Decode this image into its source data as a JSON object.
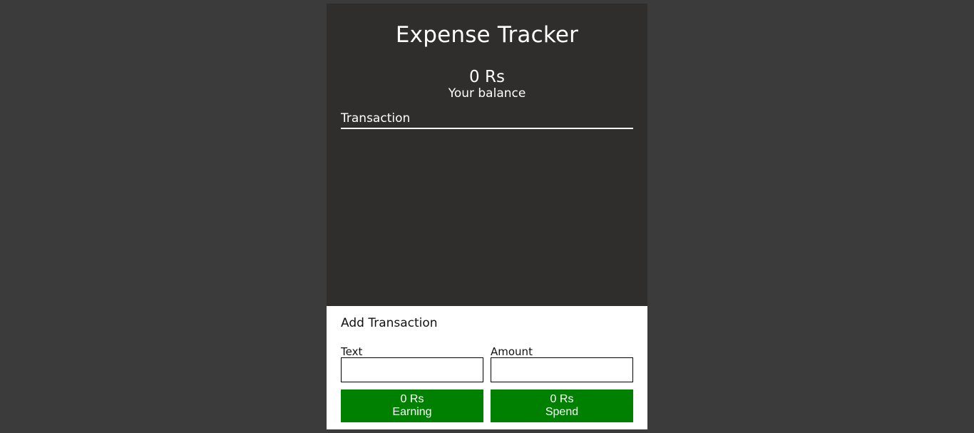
{
  "app": {
    "title": "Expense Tracker"
  },
  "balance": {
    "amount": "0 Rs",
    "label": "Your balance"
  },
  "transactions": {
    "heading": "Transaction",
    "items": []
  },
  "add_transaction": {
    "title": "Add Transaction",
    "text_field": {
      "label": "Text",
      "value": "",
      "placeholder": ""
    },
    "amount_field": {
      "label": "Amount",
      "value": "",
      "placeholder": ""
    },
    "earning_button": {
      "amount": "0 Rs",
      "label": "Earning"
    },
    "spend_button": {
      "amount": "0 Rs",
      "label": "Spend"
    }
  },
  "colors": {
    "page_background": "#3b3b3b",
    "card_background": "#2f2e2c",
    "panel_background": "#ffffff",
    "button_green": "#008000"
  }
}
